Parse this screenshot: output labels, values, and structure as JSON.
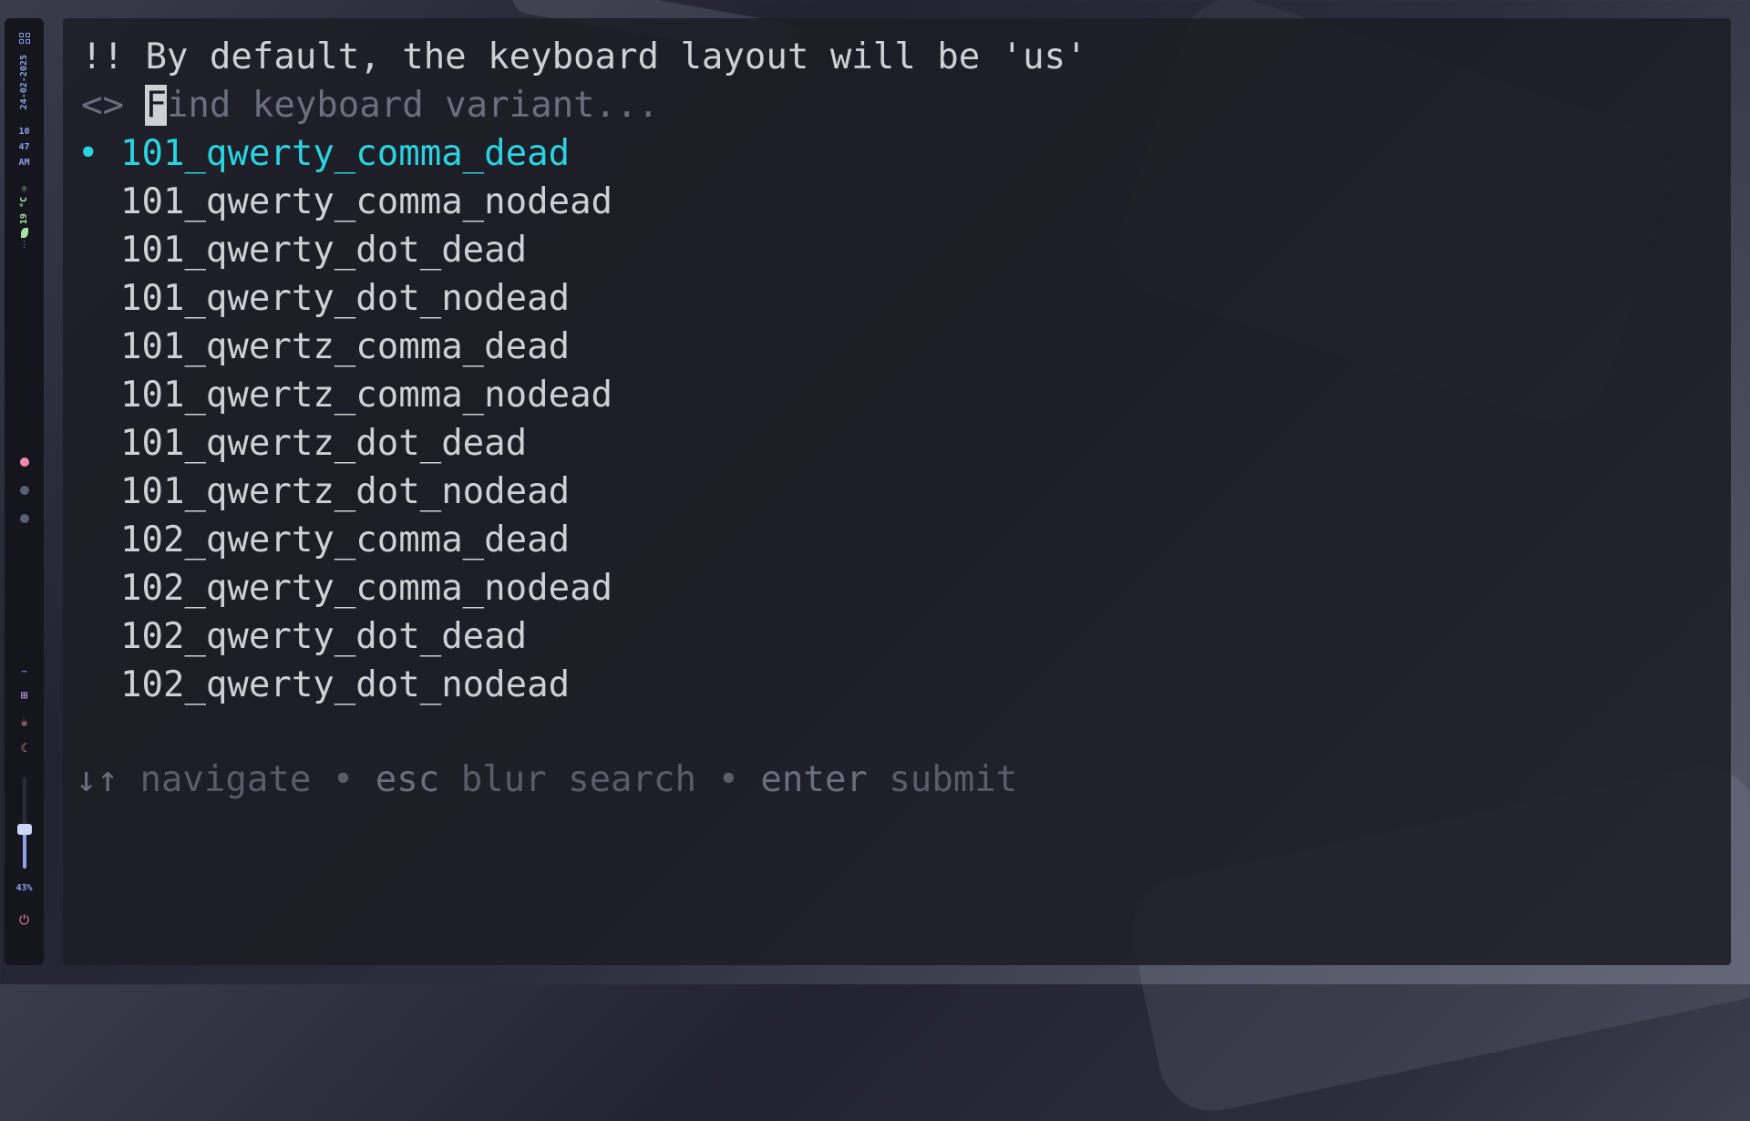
{
  "sidebar": {
    "date": "24-02-2025",
    "time": {
      "hour": "10",
      "minute": "47",
      "ampm": "AM"
    },
    "weather": {
      "temp": "19 °C"
    },
    "volume": {
      "percent_label": "43%",
      "level": 0.43
    },
    "workspaces": [
      {
        "color": "#f38ba8",
        "active": true
      },
      {
        "color": "#5c5f72",
        "active": false
      },
      {
        "color": "#5c5f72",
        "active": false
      }
    ]
  },
  "terminal": {
    "notice": {
      "mark": "!!",
      "text": "By default, the keyboard layout will be 'us'"
    },
    "search": {
      "prompt_symbol": "<>",
      "cursor_char": "F",
      "placeholder_rest": "ind keyboard variant...",
      "placeholder": "Find keyboard variant..."
    },
    "selected_bullet": "•",
    "options": [
      "101_qwerty_comma_dead",
      "101_qwerty_comma_nodead",
      "101_qwerty_dot_dead",
      "101_qwerty_dot_nodead",
      "101_qwertz_comma_dead",
      "101_qwertz_comma_nodead",
      "101_qwertz_dot_dead",
      "101_qwertz_dot_nodead",
      "102_qwerty_comma_dead",
      "102_qwerty_comma_nodead",
      "102_qwerty_dot_dead",
      "102_qwerty_dot_nodead"
    ],
    "help": {
      "navigate_key": "↓↑",
      "navigate_desc": "navigate",
      "sep": "•",
      "esc_key": "esc",
      "esc_desc": "blur search",
      "enter_key": "enter",
      "enter_desc": "submit"
    }
  },
  "colors": {
    "accent": "#2ad3e0",
    "text": "#cfd0d6",
    "muted": "#6c6e7c",
    "bar_accent": "#8ea0e8"
  }
}
